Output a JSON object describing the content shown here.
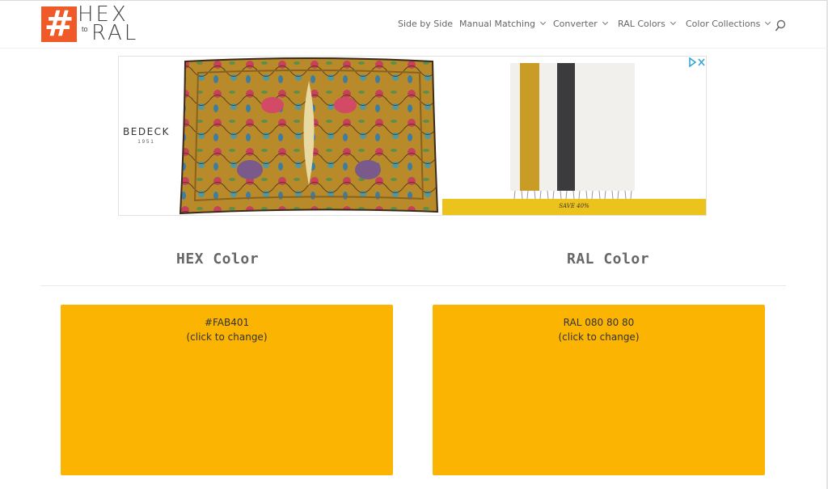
{
  "logo": {
    "hash": "#",
    "hex": "HEX",
    "to": "to",
    "ral": "RAL"
  },
  "nav": [
    {
      "label": "Side by Side",
      "dropdown": false
    },
    {
      "label": "Manual Matching",
      "dropdown": true
    },
    {
      "label": "Converter",
      "dropdown": true
    },
    {
      "label": "RAL Colors",
      "dropdown": true
    },
    {
      "label": "Color Collections",
      "dropdown": true
    }
  ],
  "search_icon": "search-icon",
  "ad": {
    "brand": "BEDECK",
    "brand_year": "1951",
    "offer": "SAVE 40%"
  },
  "columns": {
    "hex_title": "HEX Color",
    "ral_title": "RAL Color"
  },
  "hex_swatch": {
    "value": "#FAB401",
    "hint": "(click to change)",
    "color": "#FAB401"
  },
  "ral_swatch": {
    "value": "RAL 080 80 80",
    "hint": "(click to change)",
    "color": "#FAB401"
  },
  "colors": {
    "accent": "#F05A28",
    "ad_banner": "#ECC21C"
  }
}
